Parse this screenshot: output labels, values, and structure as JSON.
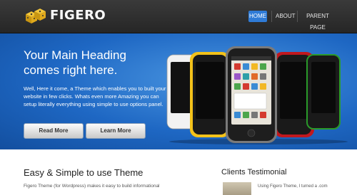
{
  "brand": {
    "name": "FIGERO",
    "icon": "dice-icon"
  },
  "nav": {
    "items": [
      {
        "label": "HOME",
        "active": true
      },
      {
        "label": "ABOUT",
        "active": false
      },
      {
        "label": "PARENT PAGE",
        "active": false
      }
    ]
  },
  "hero": {
    "heading": "Your Main Heading comes right here.",
    "body": "Well, Here it come, a Theme which enables you to built your website in few clicks. Whats even more Amazing you can setup literally everything using simple to use options panel.",
    "buttons": {
      "read_more": "Read More",
      "learn_more": "Learn More"
    },
    "image": "smartphones-illustration"
  },
  "content": {
    "heading": "Easy & Simple to use Theme",
    "text": "Figero Theme (for Wordpress) makes it easy to build informational"
  },
  "testimonial": {
    "heading": "Clients Testimonial",
    "text": "Using Figero Theme, I turned a .com"
  },
  "colors": {
    "header_bg": "#2d2d2d",
    "hero_blue": "#1e67c3",
    "nav_active": "#2f7bd6"
  }
}
